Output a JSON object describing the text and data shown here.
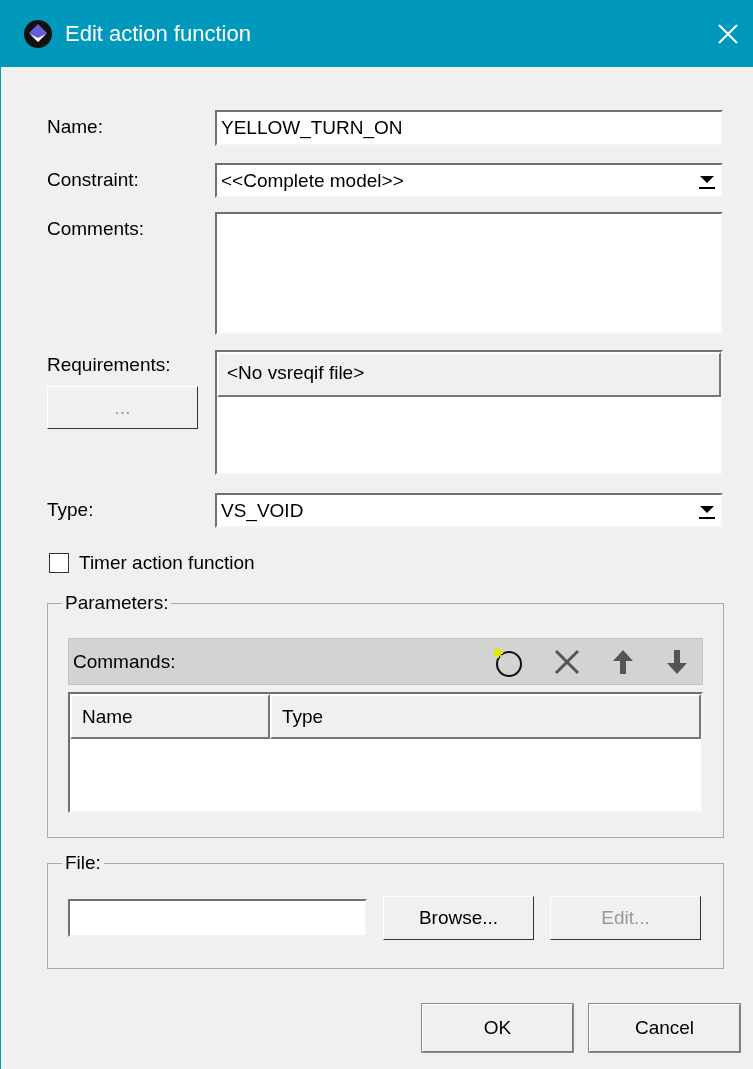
{
  "window": {
    "title": "Edit action function"
  },
  "fields": [
    {
      "kind": "text",
      "label": "Name:",
      "value": "YELLOW_TURN_ON"
    },
    {
      "kind": "dropdown",
      "label": "Constraint:",
      "value": "<<Complete model>>"
    },
    {
      "kind": "textarea",
      "label": "Comments:"
    },
    {
      "kind": "requirements",
      "label": "Requirements:",
      "button": "...",
      "file": "<No vsreqif file>"
    },
    {
      "kind": "dropdown",
      "label": "Type:",
      "value": "VS_VOID"
    }
  ],
  "timer_checkbox": {
    "label": "Timer action function",
    "checked": false
  },
  "parameters": {
    "legend": "Parameters:",
    "toolbar_label": "Commands:",
    "columns": [
      "Name",
      "Type"
    ]
  },
  "file": {
    "legend": "File:",
    "buttons": [
      {
        "label": "Browse...",
        "disabled": false
      },
      {
        "label": "Edit...",
        "disabled": true
      }
    ]
  },
  "buttons": [
    "OK",
    "Cancel"
  ]
}
